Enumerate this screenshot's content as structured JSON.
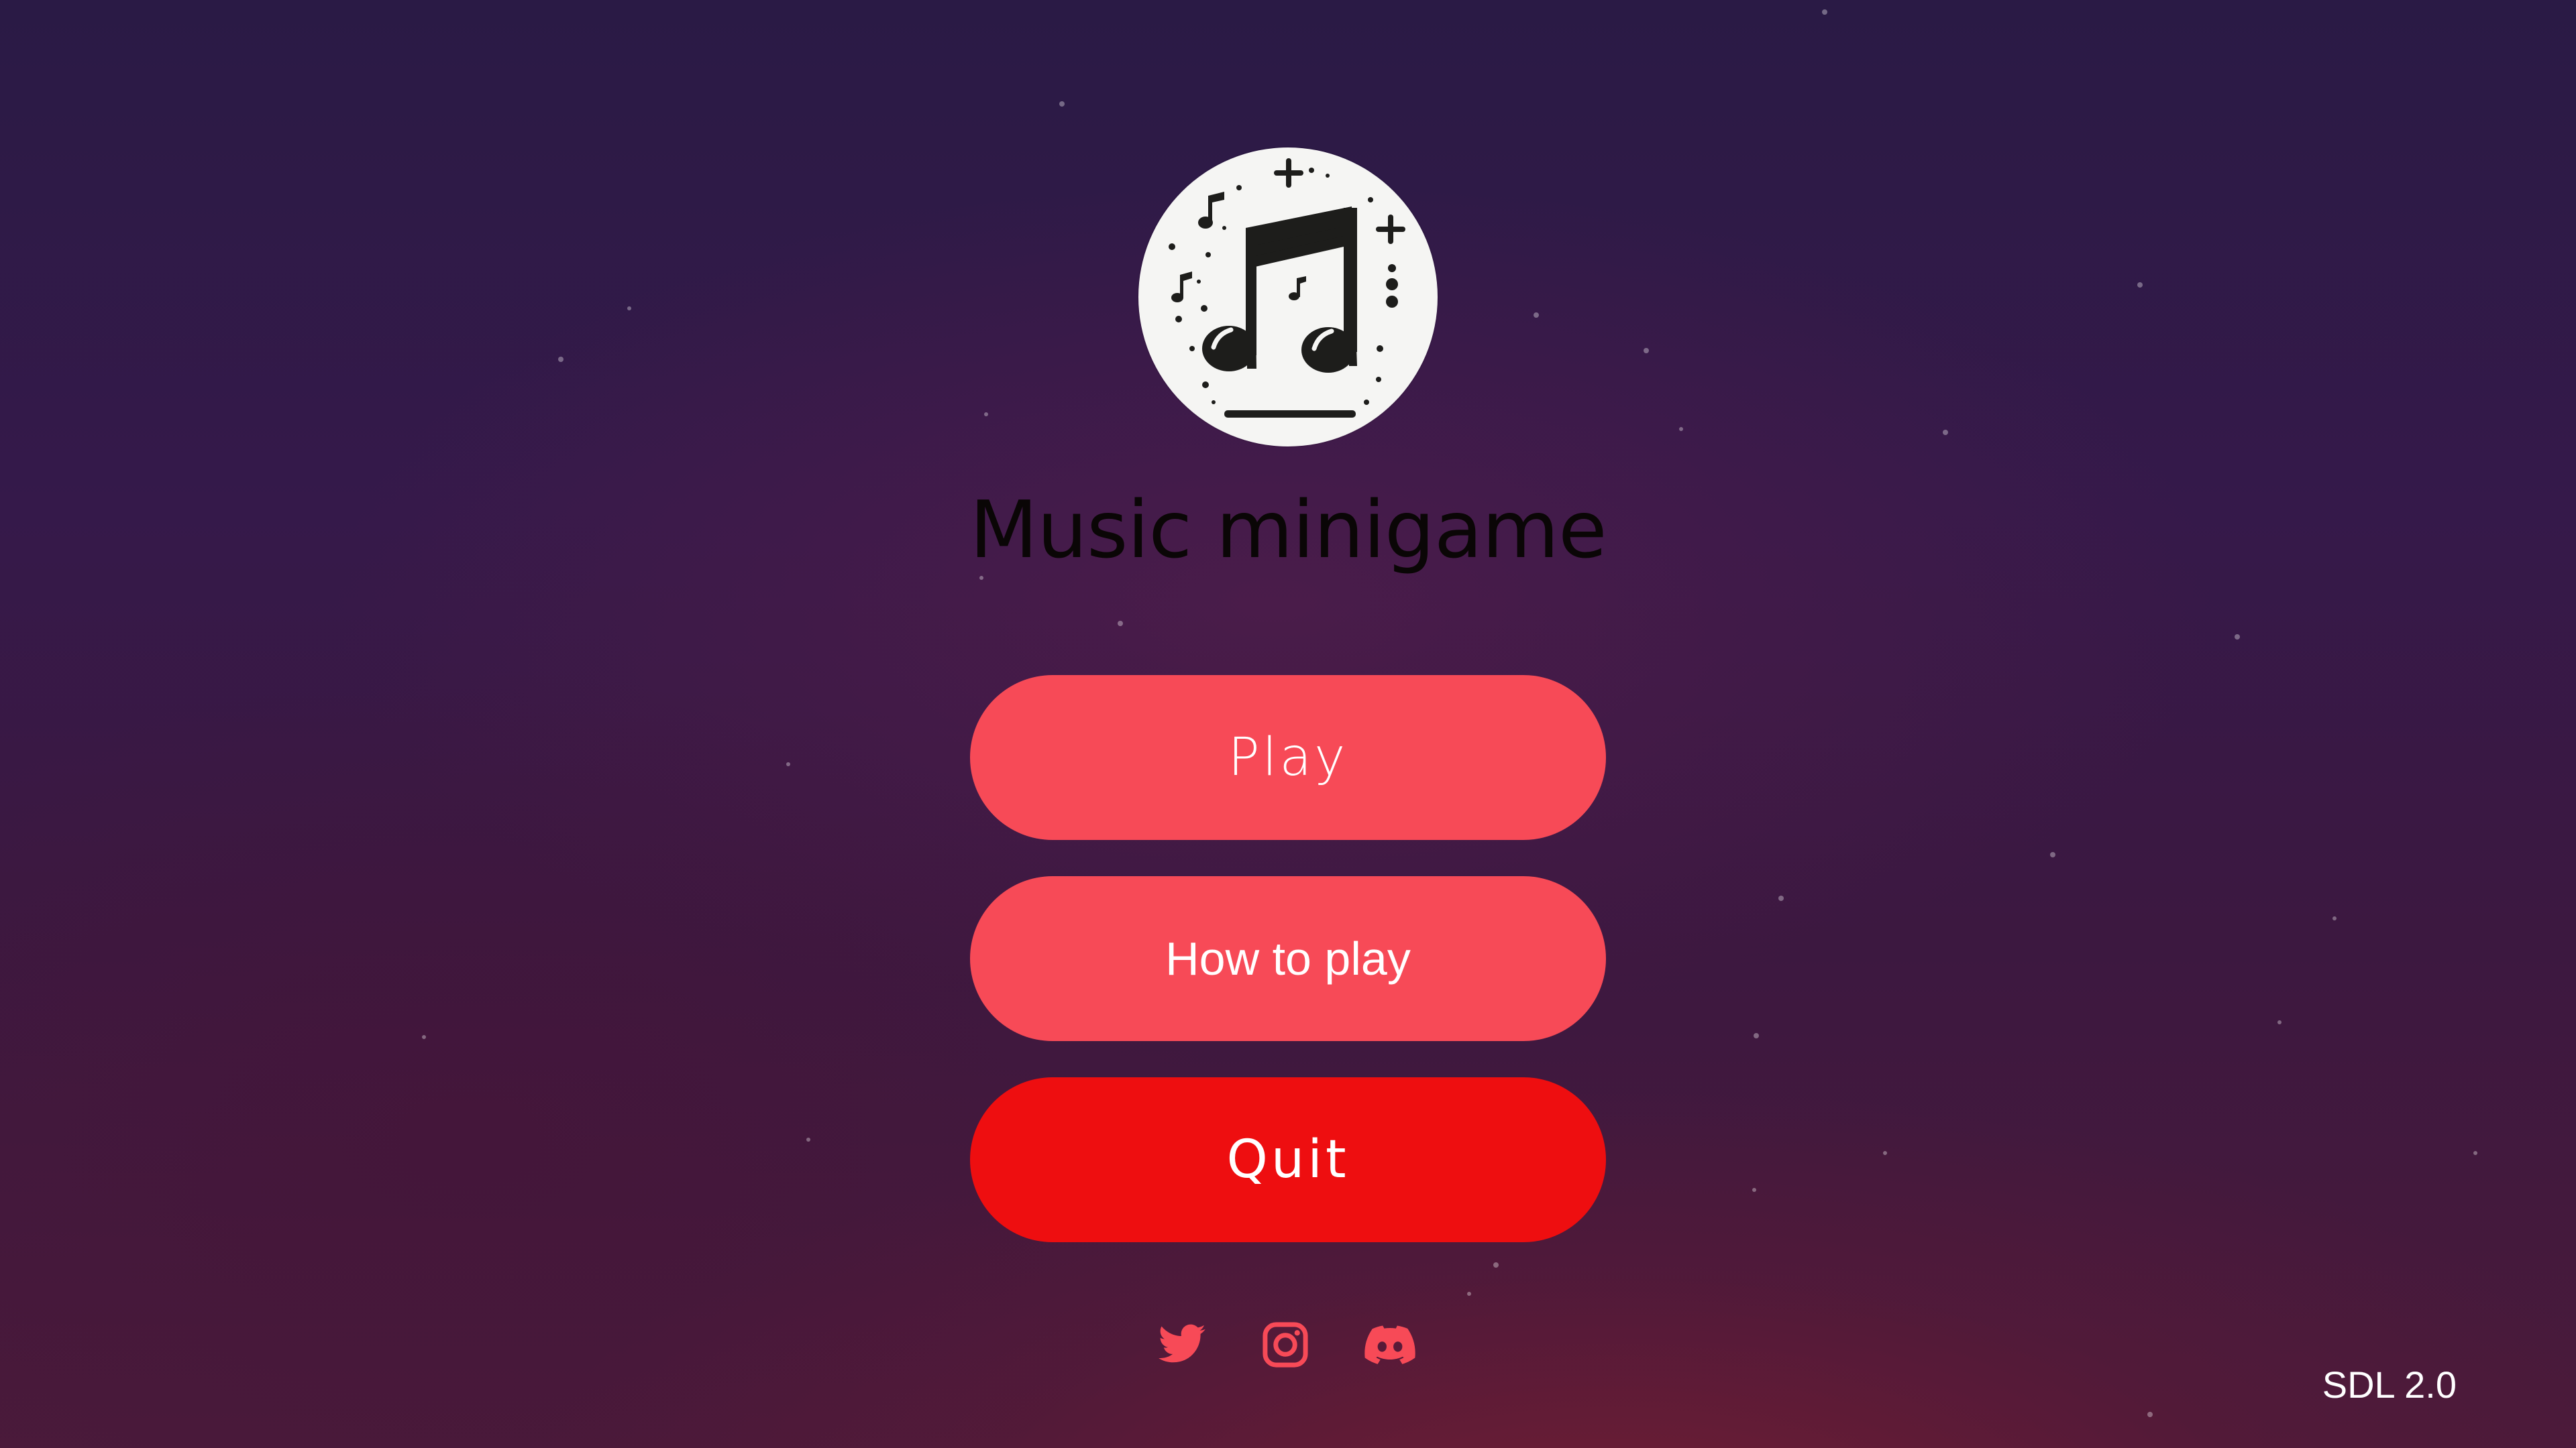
{
  "app": {
    "title": "Music minigame",
    "logo_icon": "music-note-icon"
  },
  "menu": {
    "play_label": "Play",
    "how_to_play_label": "How to play",
    "quit_label": "Quit"
  },
  "social": [
    {
      "icon": "twitter-icon"
    },
    {
      "icon": "instagram-icon"
    },
    {
      "icon": "discord-icon"
    }
  ],
  "footer": {
    "version": "SDL 2.0"
  },
  "colors": {
    "primary_button": "#f74a57",
    "quit_button": "#ee0e10",
    "social_icon": "#f74a57",
    "background_top": "#2a1a45",
    "background_bottom": "#4a1a3a"
  }
}
